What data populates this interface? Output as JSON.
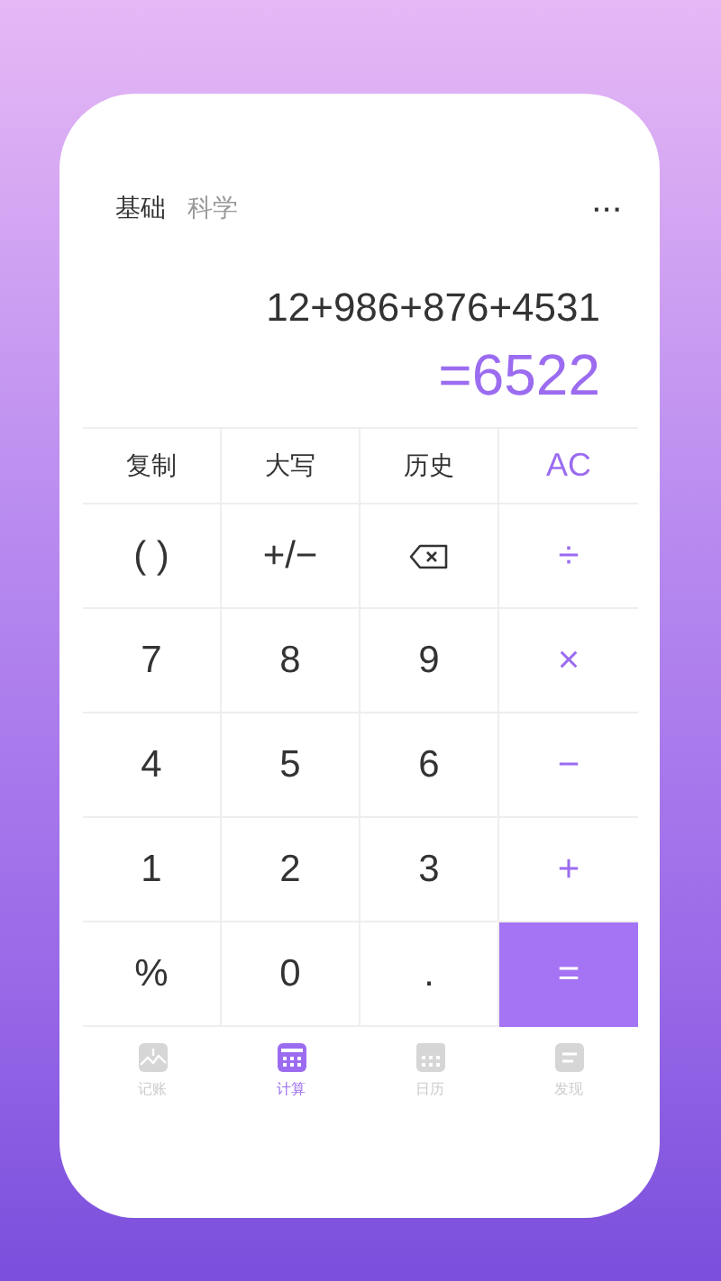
{
  "modes": [
    {
      "label": "基础",
      "selected": true
    },
    {
      "label": "科学",
      "selected": false
    }
  ],
  "menu": {
    "label": "···"
  },
  "display": {
    "expression": "12+986+876+4531",
    "result": "=6522"
  },
  "keys": [
    [
      {
        "kind": "text",
        "label": "复制"
      },
      {
        "kind": "text",
        "label": "大写"
      },
      {
        "kind": "text",
        "label": "历史"
      },
      {
        "kind": "op",
        "label": "AC"
      }
    ],
    [
      {
        "kind": "digit",
        "label": "( )"
      },
      {
        "kind": "digit",
        "label": "+/−"
      },
      {
        "kind": "backspace"
      },
      {
        "kind": "op",
        "label": "÷"
      }
    ],
    [
      {
        "kind": "digit",
        "label": "7"
      },
      {
        "kind": "digit",
        "label": "8"
      },
      {
        "kind": "digit",
        "label": "9"
      },
      {
        "kind": "op",
        "label": "×"
      }
    ],
    [
      {
        "kind": "digit",
        "label": "4"
      },
      {
        "kind": "digit",
        "label": "5"
      },
      {
        "kind": "digit",
        "label": "6"
      },
      {
        "kind": "op",
        "label": "−"
      }
    ],
    [
      {
        "kind": "digit",
        "label": "1"
      },
      {
        "kind": "digit",
        "label": "2"
      },
      {
        "kind": "digit",
        "label": "3"
      },
      {
        "kind": "op",
        "label": "+"
      }
    ],
    [
      {
        "kind": "digit",
        "label": "%"
      },
      {
        "kind": "digit",
        "label": "0"
      },
      {
        "kind": "digit",
        "label": "."
      },
      {
        "kind": "equals",
        "label": "="
      }
    ]
  ],
  "nav": [
    {
      "kind": "ledger",
      "label": "记账",
      "selected": false
    },
    {
      "kind": "calculator",
      "label": "计算",
      "selected": true
    },
    {
      "kind": "calendar",
      "label": "日历",
      "selected": false
    },
    {
      "kind": "note",
      "label": "发现",
      "selected": false
    }
  ]
}
